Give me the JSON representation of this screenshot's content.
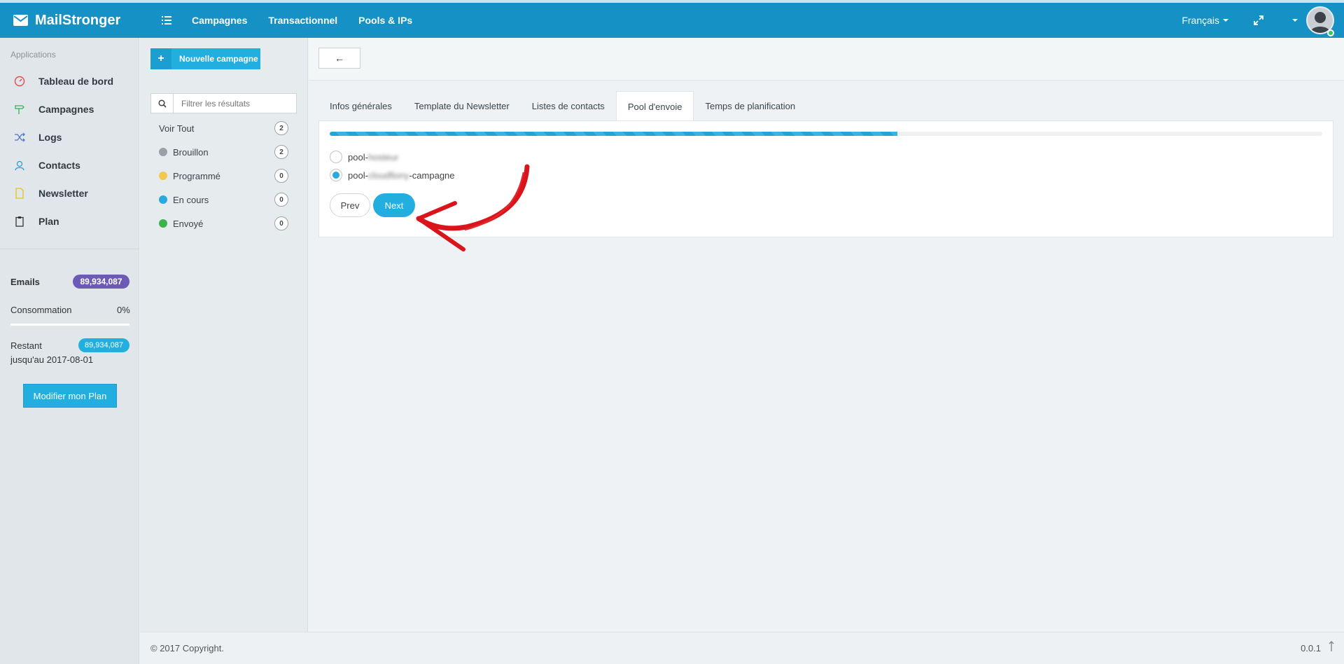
{
  "app": {
    "name": "MailStronger"
  },
  "topnav": {
    "items": [
      "Campagnes",
      "Transactionnel",
      "Pools & IPs"
    ],
    "language": "Français"
  },
  "sidebar": {
    "heading": "Applications",
    "items": [
      {
        "label": "Tableau de bord",
        "icon": "dashboard-icon",
        "color": "#e04b4b"
      },
      {
        "label": "Campagnes",
        "icon": "signpost-icon",
        "color": "#35b35a"
      },
      {
        "label": "Logs",
        "icon": "shuffle-icon",
        "color": "#4a78c9"
      },
      {
        "label": "Contacts",
        "icon": "contact-icon",
        "color": "#2a9fd6"
      },
      {
        "label": "Newsletter",
        "icon": "file-icon",
        "color": "#e8c31c"
      },
      {
        "label": "Plan",
        "icon": "clipboard-icon",
        "color": "#333333"
      }
    ],
    "stats": {
      "emails_label": "Emails",
      "emails_value": "89,934,087",
      "consumption_label": "Consommation",
      "consumption_value": "0%",
      "remaining_label": "Restant",
      "remaining_until": "jusqu'au 2017-08-01",
      "remaining_value": "89,934,087"
    },
    "plan_button": "Modifier mon Plan"
  },
  "campaigns": {
    "new_button": "Nouvelle campagne",
    "filter_placeholder": "Filtrer les résultats",
    "statuses": [
      {
        "label": "Voir Tout",
        "count": "2",
        "color": ""
      },
      {
        "label": "Brouillon",
        "count": "2",
        "color": "#9aa0a5"
      },
      {
        "label": "Programmé",
        "count": "0",
        "color": "#f2c94c"
      },
      {
        "label": "En cours",
        "count": "0",
        "color": "#2aa9de"
      },
      {
        "label": "Envoyé",
        "count": "0",
        "color": "#3cb34a"
      }
    ]
  },
  "wizard": {
    "back_symbol": "←",
    "tabs": [
      "Infos générales",
      "Template du Newsletter",
      "Listes de contacts",
      "Pool d'envoie",
      "Temps de planification"
    ],
    "active_tab": 3,
    "progress_fraction": 0.572,
    "options": [
      {
        "prefix": "pool-",
        "blurred": "hosteur",
        "suffix": "",
        "checked": false
      },
      {
        "prefix": "pool-",
        "blurred": "cloudfiony",
        "suffix": "-campagne",
        "checked": true
      }
    ],
    "prev_label": "Prev",
    "next_label": "Next"
  },
  "footer": {
    "copyright": "© 2017 Copyright.",
    "version": "0.0.1"
  }
}
